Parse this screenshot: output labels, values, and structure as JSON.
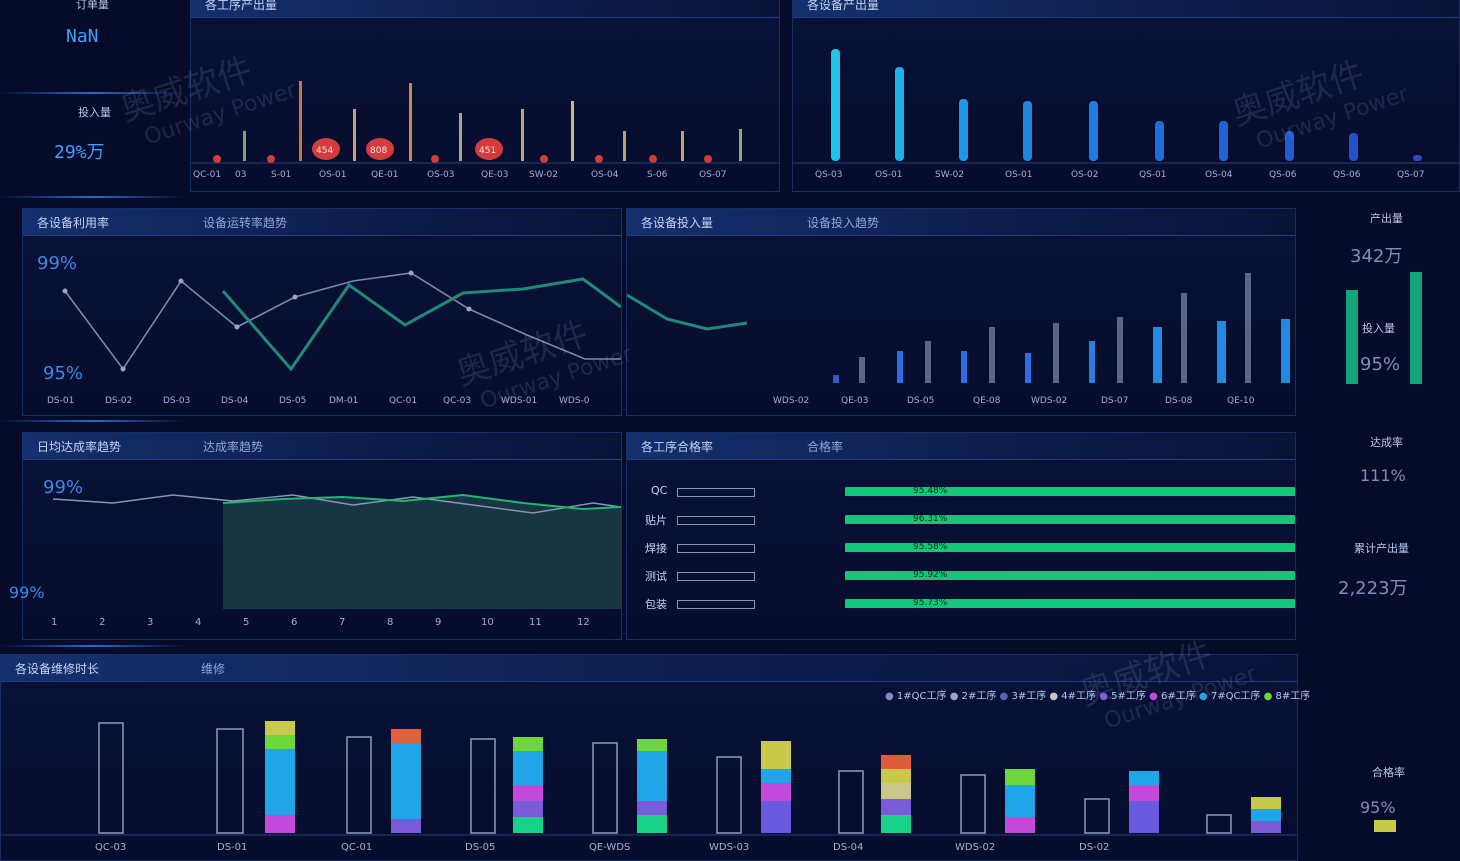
{
  "left_side": {
    "top_label": "订单量",
    "top_value": "NaN",
    "input_label": "投入量",
    "input_value": "29%万"
  },
  "panels": {
    "p1": {
      "title": "各工序产出量"
    },
    "p2": {
      "title": "各设备产出量"
    },
    "p3": {
      "title": "各设备利用率",
      "subtitle": "设备运转率趋势"
    },
    "p4": {
      "title": "各设备投入量",
      "subtitle": "设备投入趋势"
    },
    "p5": {
      "title": "日均达成率趋势",
      "subtitle": "达成率趋势"
    },
    "p6": {
      "title": "各工序合格率",
      "subtitle": "合格率"
    },
    "p7": {
      "title": "各设备维修时长",
      "subtitle": "维修"
    }
  },
  "right_side": {
    "r1_label": "产出量",
    "r1_value": "342万",
    "r2_label": "投入量",
    "r2_value": "95%",
    "r3_label": "达成率",
    "r3_value": "111%",
    "r4_label": "累计产出量",
    "r4_value": "2,223万",
    "r5_label": "合格率",
    "r5_value": "95%"
  },
  "left_kpis": {
    "k1": "99%",
    "k2": "99%",
    "k3": "95%",
    "k4": "99%"
  },
  "chart1_labels": [
    "QC-01",
    "03",
    "S-01",
    "OS-01",
    "QE-01",
    "OS-03",
    "QE-03",
    "SW-02",
    "OS-04",
    "S-06",
    "OS-07"
  ],
  "chart1_bubbles": [
    "454",
    "808",
    "451"
  ],
  "chart2_labels": [
    "QS-03",
    "OS-01",
    "SW-02",
    "OS-01",
    "OS-02",
    "QS-01",
    "OS-04",
    "QS-06",
    "QS-06",
    "QS-07",
    "OS-01"
  ],
  "chart3_labels": [
    "DS-01",
    "DS-02",
    "DS-03",
    "DS-04",
    "DS-05",
    "DM-01",
    "QC-01",
    "QC-03",
    "WDS-01",
    "WDS-0"
  ],
  "chart4_labels": [
    "WDS-02",
    "QE-03",
    "DS-05",
    "QE-08",
    "WDS-02",
    "DS-07",
    "DS-08",
    "QE-10"
  ],
  "chart5_labels": [
    "1",
    "2",
    "3",
    "4",
    "5",
    "6",
    "7",
    "8",
    "9",
    "10",
    "11",
    "12"
  ],
  "chart6": {
    "rows": [
      {
        "label": "QC",
        "pct": "95.48%",
        "value": 0.9548
      },
      {
        "label": "贴片",
        "pct": "96.31%",
        "value": 0.9631
      },
      {
        "label": "焊接",
        "pct": "95.58%",
        "value": 0.9558
      },
      {
        "label": "测试",
        "pct": "95.92%",
        "value": 0.9592
      },
      {
        "label": "包装",
        "pct": "95.73%",
        "value": 0.9573
      }
    ]
  },
  "chart7": {
    "legend": [
      "1#QC工序",
      "2#工序",
      "3#工序",
      "4#工序",
      "5#工序",
      "6#工序",
      "7#QC工序",
      "8#工序"
    ],
    "labels": [
      "QC-03",
      "DS-01",
      "QC-01",
      "DS-05",
      "QE-WDS",
      "WDS-03",
      "DS-04",
      "WDS-02",
      "DS-02"
    ]
  },
  "colors": {
    "accent_blue": "#1f78e0",
    "cyan": "#1fc3e6",
    "green": "#10c77a",
    "bubble_red": "#d23c3c"
  },
  "watermark": {
    "cn": "奥威软件",
    "en": "Ourway Power"
  }
}
